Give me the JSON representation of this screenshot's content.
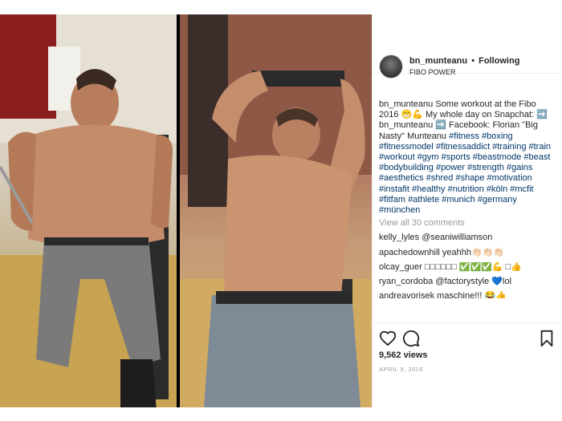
{
  "post": {
    "username": "bn_munteanu",
    "follow_label": "Following",
    "location": "FIBO POWER",
    "caption_user": "bn_munteanu",
    "caption_text": "Some workout at the Fibo 2016 😁💪 My whole day on Snapchat: ➡️ bn_munteanu ➡️ Facebook: Florian \"Big Nasty\" Munteanu",
    "hashtags": "#fitness #boxing #fitnessmodel #fitnessaddict #training #train #workout #gym #sports #beastmode #beast #bodybuilding #power #strength #gains #aesthetics #shred #shape #motivation #instafit #healthy #nutrition #köln #mcfit #fitfam #athlete #munich #germany #münchen",
    "view_all_comments": "View all 30 comments",
    "comments": [
      {
        "user": "kelly_lyles",
        "text": "@seaniwilliamson"
      },
      {
        "user": "apachedownhill",
        "text": "yeahhh👏🏻👏🏻👏🏻"
      },
      {
        "user": "olcay_guer",
        "text": "□□□□□□ ✅✅✅💪 □👍"
      },
      {
        "user": "ryan_cordoba",
        "text": "@factorystyle 💙lol"
      },
      {
        "user": "andreavorisek",
        "text": "maschine!!! 😂👍"
      }
    ],
    "views": "9,562 views",
    "date": "APRIL 9, 2016"
  },
  "icons": {
    "like": "heart-icon",
    "comment": "comment-icon",
    "save": "bookmark-icon"
  },
  "colors": {
    "hashtag": "#003569",
    "muted": "#999999",
    "border": "#efefef"
  }
}
